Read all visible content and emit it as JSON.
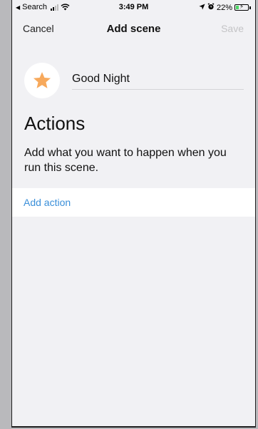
{
  "status_bar": {
    "back_app": "Search",
    "time": "3:49 PM",
    "battery": "22%",
    "battery_level": 0.22,
    "colors": {
      "battery_fill": "#4cd964"
    }
  },
  "nav": {
    "cancel_label": "Cancel",
    "title": "Add scene",
    "save_label": "Save"
  },
  "scene": {
    "name": "Good Night",
    "icon": "star-icon",
    "icon_color": "#f7a95c"
  },
  "actions": {
    "heading": "Actions",
    "description": "Add what you want to happen when you run this scene.",
    "add_action_label": "Add action",
    "link_color": "#3a8fd9"
  }
}
